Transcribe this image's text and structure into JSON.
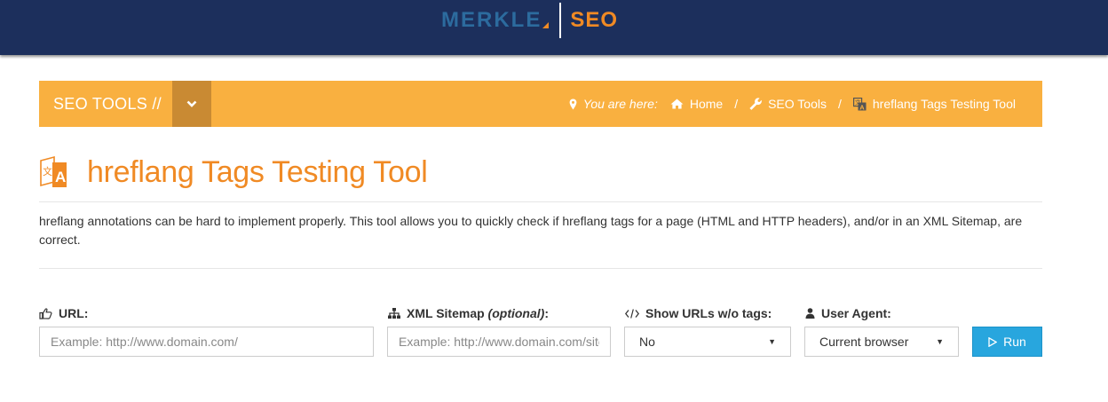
{
  "header": {
    "logo_merkle": "MERKLE",
    "logo_seo": "SEO",
    "colors": {
      "navy": "#1c2f5c",
      "merkle_blue": "#2c6b9e",
      "orange": "#f08a24"
    }
  },
  "toolbar": {
    "tools_label": "SEO TOOLS //",
    "toggle_icon": "chevron-down-icon",
    "color": "#f9b040",
    "breadcrumb": {
      "you_are_here": "You are here:",
      "items": [
        {
          "icon": "home-icon",
          "label": "Home"
        },
        {
          "icon": "wrench-icon",
          "label": "SEO Tools"
        },
        {
          "icon": "translate-icon",
          "label": "hreflang Tags Testing Tool"
        }
      ],
      "separator": "/"
    }
  },
  "page": {
    "title": "hreflang Tags Testing Tool",
    "title_icon": "translate-icon",
    "description": "hreflang annotations can be hard to implement properly. This tool allows you to quickly check if hreflang tags for a page (HTML and HTTP headers), and/or in an XML Sitemap, are correct."
  },
  "form": {
    "url": {
      "icon": "thumbs-up-icon",
      "label": "URL:",
      "placeholder": "Example: http://www.domain.com/",
      "value": ""
    },
    "sitemap": {
      "icon": "sitemap-icon",
      "label": "XML Sitemap",
      "label_optional": "(optional)",
      "label_suffix": ":",
      "placeholder": "Example: http://www.domain.com/sitemap.xml",
      "value": ""
    },
    "show_urls": {
      "icon": "code-icon",
      "label": "Show URLs w/o tags:",
      "selected": "No"
    },
    "user_agent": {
      "icon": "user-icon",
      "label": "User Agent:",
      "selected": "Current browser"
    },
    "run": {
      "icon": "play-icon",
      "label": "Run",
      "color": "#28a6de"
    }
  }
}
